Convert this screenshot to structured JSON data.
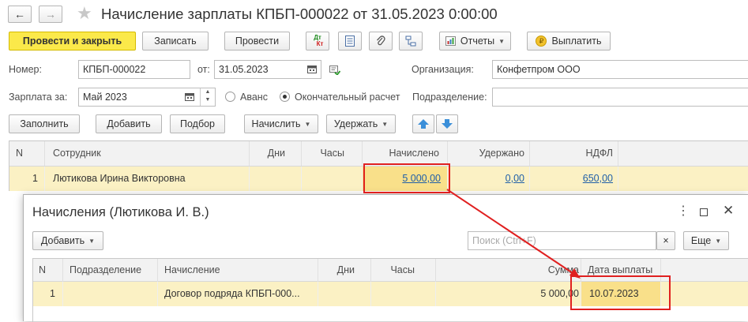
{
  "window": {
    "title": "Начисление зарплаты КПБП-000022 от 31.05.2023 0:00:00"
  },
  "nav": {
    "back": "←",
    "forward": "→",
    "star": "★"
  },
  "toolbar": {
    "post_close": "Провести и закрыть",
    "save": "Записать",
    "post": "Провести",
    "dtkt_top": "Дт",
    "dtkt_bottom": "Кт",
    "reports": "Отчеты",
    "pay": "Выплатить",
    "pay_coin": "₽"
  },
  "header": {
    "number_label": "Номер:",
    "number_value": "КПБП-000022",
    "date_label": "от:",
    "date_value": "31.05.2023",
    "org_label": "Организация:",
    "org_value": "Конфетпром ООО",
    "salary_for_label": "Зарплата за:",
    "salary_for_value": "Май 2023",
    "advance_label": "Аванс",
    "final_label": "Окончательный расчет",
    "division_label": "Подразделение:",
    "division_value": ""
  },
  "table_toolbar": {
    "fill": "Заполнить",
    "add": "Добавить",
    "select": "Подбор",
    "accrue": "Начислить",
    "withhold": "Удержать"
  },
  "main_table": {
    "columns": [
      "N",
      "Сотрудник",
      "Дни",
      "Часы",
      "Начислено",
      "Удержано",
      "НДФЛ"
    ],
    "rows": [
      {
        "n": "1",
        "employee": "Лютикова Ирина Викторовна",
        "days": "",
        "hours": "",
        "accrued": "5 000,00",
        "withheld": "0,00",
        "ndfl": "650,00"
      }
    ]
  },
  "popup": {
    "title": "Начисления (Лютикова И. В.)",
    "add": "Добавить",
    "search_placeholder": "Поиск (Ctrl+F)",
    "clear": "×",
    "more": "Еще",
    "columns": [
      "N",
      "Подразделение",
      "Начисление",
      "Дни",
      "Часы",
      "Сумма",
      "Дата выплаты"
    ],
    "rows": [
      {
        "n": "1",
        "division": "",
        "accrual": "Договор подряда КПБП-000...",
        "days": "",
        "hours": "",
        "sum": "5 000,00",
        "pay_date": "10.07.2023"
      }
    ]
  },
  "colors": {
    "accent_yellow": "#fbe94a",
    "selected_row": "#fbf1c4",
    "highlight_red": "#e02020",
    "link": "#1f5fa8"
  }
}
